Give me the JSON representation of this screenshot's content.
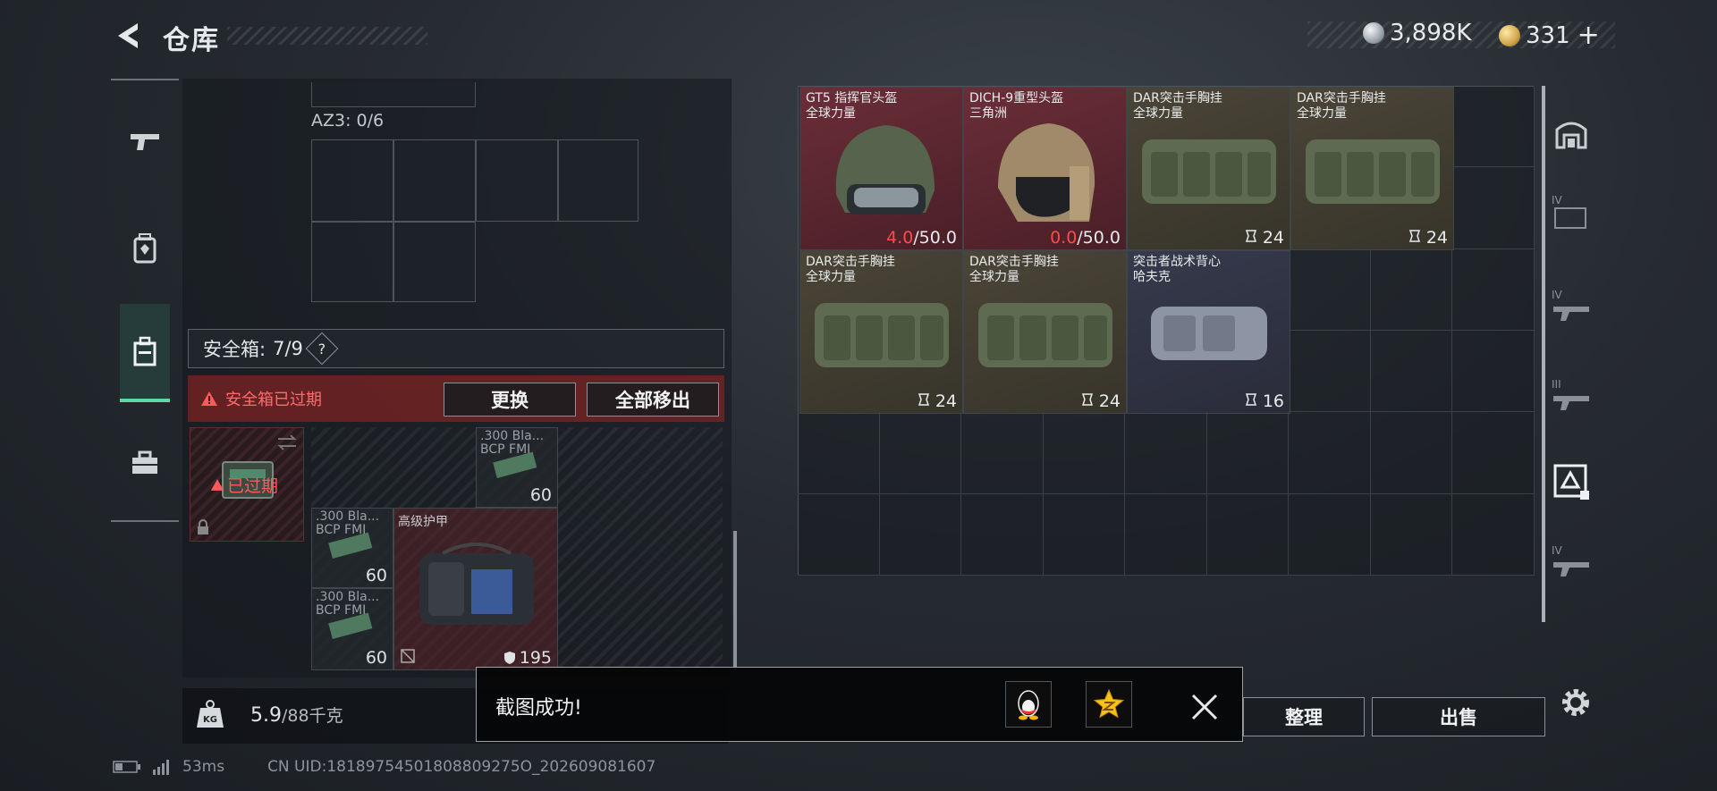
{
  "header": {
    "title": "仓库",
    "currency_silver": "3,898K",
    "currency_gold": "331",
    "currency_add": "+"
  },
  "left_nav": {
    "items": [
      {
        "name": "weapons"
      },
      {
        "name": "equipment"
      },
      {
        "name": "safe-box",
        "active": true
      },
      {
        "name": "toolbox"
      }
    ]
  },
  "container": {
    "az3_label": "AZ3: 0/6"
  },
  "safe": {
    "header_label": "安全箱:",
    "header_count": "7/9",
    "help": "?",
    "expired_warning": "安全箱已过期",
    "replace_button": "更换",
    "move_all_button": "全部移出",
    "box_badge": "已过期",
    "items": [
      {
        "name_line1": ".300 Bla...",
        "name_line2": "BCP FMJ",
        "count": "60"
      },
      {
        "name_line1": ".300 Bla...",
        "name_line2": "BCP FMJ",
        "count": "60"
      },
      {
        "name_line1": ".300 Bla...",
        "name_line2": "BCP FMJ",
        "count": "60"
      },
      {
        "name_line1": "高级护甲",
        "count": "195"
      }
    ]
  },
  "weight": {
    "icon_label": "KG",
    "current": "5.9",
    "max": "/88千克"
  },
  "inventory": {
    "items": [
      {
        "name": "GT5 指挥官头盔",
        "sub": "全球力量",
        "dur_current": "4.0",
        "dur_max": "/50.0"
      },
      {
        "name": "DICH-9重型头盔",
        "sub": "三角洲",
        "dur_current": "0.0",
        "dur_max": "/50.0"
      },
      {
        "name": "DAR突击手胸挂",
        "sub": "全球力量",
        "capacity": "24"
      },
      {
        "name": "DAR突击手胸挂",
        "sub": "全球力量",
        "capacity": "24"
      },
      {
        "name": "DAR突击手胸挂",
        "sub": "全球力量",
        "capacity": "24"
      },
      {
        "name": "DAR突击手胸挂",
        "sub": "全球力量",
        "capacity": "24"
      },
      {
        "name": "突击者战术背心",
        "sub": "哈夫克",
        "capacity": "16"
      }
    ]
  },
  "right_nav": {
    "tier_labels": [
      "IV",
      "IV",
      "III",
      "IV"
    ]
  },
  "actions": {
    "sort_button": "整理",
    "sell_button": "出售"
  },
  "toast": {
    "message": "截图成功!"
  },
  "footer": {
    "ping": "53ms",
    "uid": "CN UID:18189754501808809275O_202609081607"
  },
  "colors": {
    "accent_green": "#5fd7a6",
    "warning_red": "#ff4a4a",
    "helmet_bg": "#5a2a30",
    "rig_bg": "#3d3a30",
    "vest_bg": "#2d2f3d"
  }
}
